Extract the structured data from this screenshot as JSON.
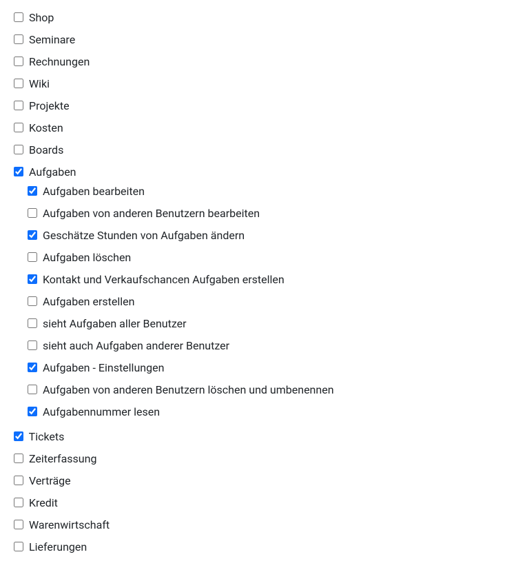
{
  "permissions": {
    "shop": {
      "label": "Shop",
      "checked": false
    },
    "seminare": {
      "label": "Seminare",
      "checked": false
    },
    "rechnungen": {
      "label": "Rechnungen",
      "checked": false
    },
    "wiki": {
      "label": "Wiki",
      "checked": false
    },
    "projekte": {
      "label": "Projekte",
      "checked": false
    },
    "kosten": {
      "label": "Kosten",
      "checked": false
    },
    "boards": {
      "label": "Boards",
      "checked": false
    },
    "aufgaben": {
      "label": "Aufgaben",
      "checked": true,
      "children": {
        "bearbeiten": {
          "label": "Aufgaben bearbeiten",
          "checked": true
        },
        "andere_bearbeiten": {
          "label": "Aufgaben von anderen Benutzern bearbeiten",
          "checked": false
        },
        "stunden": {
          "label": "Geschätze Stunden von Aufgaben ändern",
          "checked": true
        },
        "loeschen": {
          "label": "Aufgaben löschen",
          "checked": false
        },
        "kontakt": {
          "label": "Kontakt und Verkaufschancen Aufgaben erstellen",
          "checked": true
        },
        "erstellen": {
          "label": "Aufgaben erstellen",
          "checked": false
        },
        "sieht_alle": {
          "label": "sieht Aufgaben aller Benutzer",
          "checked": false
        },
        "sieht_andere": {
          "label": "sieht auch Aufgaben anderer Benutzer",
          "checked": false
        },
        "einstellungen": {
          "label": "Aufgaben - Einstellungen",
          "checked": true
        },
        "andere_loeschen": {
          "label": "Aufgaben von anderen Benutzern löschen und umbenennen",
          "checked": false
        },
        "nummer_lesen": {
          "label": "Aufgabennummer lesen",
          "checked": true
        }
      }
    },
    "tickets": {
      "label": "Tickets",
      "checked": true
    },
    "zeiterfassung": {
      "label": "Zeiterfassung",
      "checked": false
    },
    "vertraege": {
      "label": "Verträge",
      "checked": false
    },
    "kredit": {
      "label": "Kredit",
      "checked": false
    },
    "warenwirtschaft": {
      "label": "Warenwirtschaft",
      "checked": false
    },
    "lieferungen": {
      "label": "Lieferungen",
      "checked": false
    }
  }
}
